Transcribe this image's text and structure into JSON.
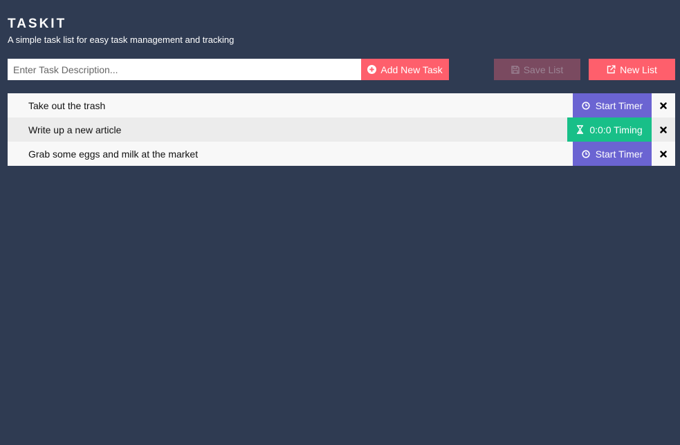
{
  "app": {
    "title": "TASKIT",
    "subtitle": "A simple task list for easy task management and tracking"
  },
  "toolbar": {
    "task_input_placeholder": "Enter Task Description...",
    "add_label": "Add New Task",
    "save_label": "Save List",
    "new_label": "New List"
  },
  "tasks": [
    {
      "text": "Take out the trash",
      "timer_label": "Start Timer",
      "timer_state": "idle"
    },
    {
      "text": "Write up a new article",
      "timer_label": "0:0:0 Timing",
      "timer_state": "timing"
    },
    {
      "text": "Grab some eggs and milk at the market",
      "timer_label": "Start Timer",
      "timer_state": "idle"
    }
  ],
  "colors": {
    "background": "#2f3b52",
    "accent": "#fe5f6c",
    "save_disabled": "#7a4a60",
    "start_timer": "#6b64d2",
    "timing": "#18bf88"
  },
  "icons": {
    "add": "plus-circle-icon",
    "save": "floppy-disk-icon",
    "new": "external-link-icon",
    "start_timer": "clock-icon",
    "timing": "hourglass-icon",
    "delete": "close-icon"
  }
}
